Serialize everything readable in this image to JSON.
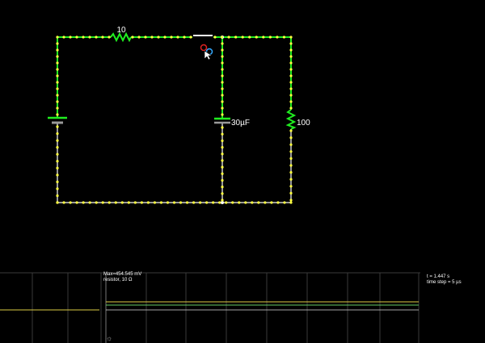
{
  "circuit": {
    "resistor_top_label": "10",
    "capacitor_label": "30µF",
    "resistor_right_label": "100",
    "colors": {
      "hot": "#20ee20",
      "cold": "#999999",
      "dot": "#ffff40",
      "switch": "#ffffff"
    },
    "icons": [
      "battery-icon",
      "resistor-icon",
      "capacitor-icon",
      "switch-icon",
      "pointer-cursor-icon"
    ]
  },
  "scope": {
    "max_text": "Max=454.545 mV",
    "element_text": "resistor, 10 Ω",
    "time_text": "t = 1.447 s",
    "timestep_text": "time step = 5 µs",
    "settings_icon": "gear-icon"
  }
}
